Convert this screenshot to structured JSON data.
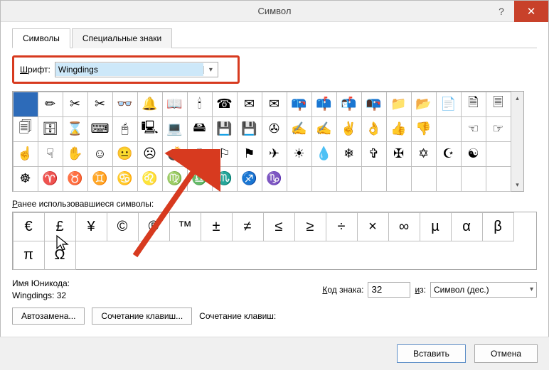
{
  "title": "Символ",
  "tabs": {
    "symbols": "Символы",
    "special": "Специальные знаки"
  },
  "font_label": "Шрифт:",
  "font_value": "Wingdings",
  "grid": [
    [
      "",
      "✏",
      "✂",
      "✂",
      "👓",
      "🔔",
      "📖",
      "🕯",
      "☎",
      "✉",
      "✉",
      "📪",
      "📫",
      "📬",
      "📭",
      "📁",
      "📂",
      "📄",
      "🗎",
      "🗏"
    ],
    [
      "🗐",
      "🗄",
      "⌛",
      "⌨",
      "🖰",
      "🖳",
      "💻",
      "🖴",
      "💾",
      "💾",
      "✇",
      "✍",
      "✍",
      "✌",
      "👌",
      "👍",
      "👎",
      " ",
      "☜",
      "☞"
    ],
    [
      "☝",
      "☟",
      "✋",
      "☺",
      "😐",
      "☹",
      "💣",
      "☠",
      "⚐",
      "⚑",
      "✈",
      "☀",
      "💧",
      "❄",
      "✞",
      "✠",
      "✡",
      "☪",
      "☯",
      " "
    ],
    [
      "☸",
      "♈",
      "♉",
      "♊",
      "♋",
      "♌",
      "♍",
      "♎",
      "♏",
      "♐",
      "♑",
      "",
      "",
      "",
      "",
      "",
      "",
      "",
      "",
      ""
    ]
  ],
  "recent_label": "Ранее использовавшиеся символы:",
  "recent": [
    "€",
    "£",
    "¥",
    "©",
    "®",
    "™",
    "±",
    "≠",
    "≤",
    "≥",
    "÷",
    "×",
    "∞",
    "µ",
    "α",
    "β",
    "π",
    "Ω"
  ],
  "unicode_name_label": "Имя Юникода:",
  "font_code_label": "Wingdings: 32",
  "code_label": "Код знака:",
  "code_value": "32",
  "from_label": "из:",
  "from_value": "Символ (дес.)",
  "autocorrect": "Автозамена...",
  "shortcut_btn": "Сочетание клавиш...",
  "shortcut_label": "Сочетание клавиш:",
  "insert": "Вставить",
  "cancel": "Отмена"
}
